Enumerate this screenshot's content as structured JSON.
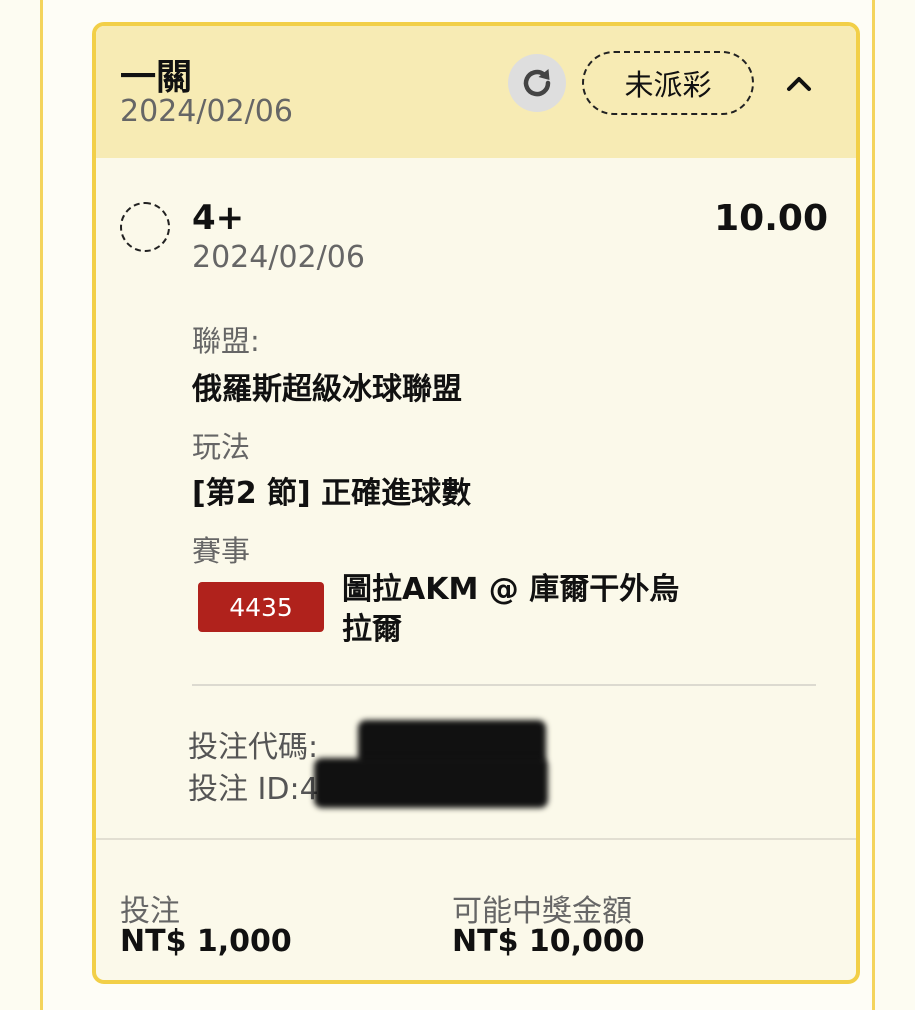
{
  "header": {
    "title": "一關",
    "date": "2024/02/06",
    "status": "未派彩",
    "icons": {
      "refresh": "refresh-icon",
      "collapse": "chevron-up-icon"
    }
  },
  "selection": {
    "pick": "4+",
    "date": "2024/02/06",
    "odds": "10.00",
    "league_label": "聯盟:",
    "league": "俄羅斯超級冰球聯盟",
    "market_label": "玩法",
    "market": "[第2 節] 正確進球數",
    "event_label": "賽事",
    "event_id": "4435",
    "event_name": "圖拉AKM @ 庫爾干外烏拉爾"
  },
  "bet_info": {
    "code_label": "投注代碼:",
    "code_visible": ": 4",
    "id_label": "投注 ID:",
    "id_visible": "48"
  },
  "footer": {
    "stake_label": "投注",
    "stake_value": "NT$ 1,000",
    "payout_label": "可能中獎金額",
    "payout_value": "NT$ 10,000"
  },
  "colors": {
    "accent_border": "#f2cf48",
    "header_bg": "#f7ebb4",
    "event_badge": "#b0221c"
  }
}
